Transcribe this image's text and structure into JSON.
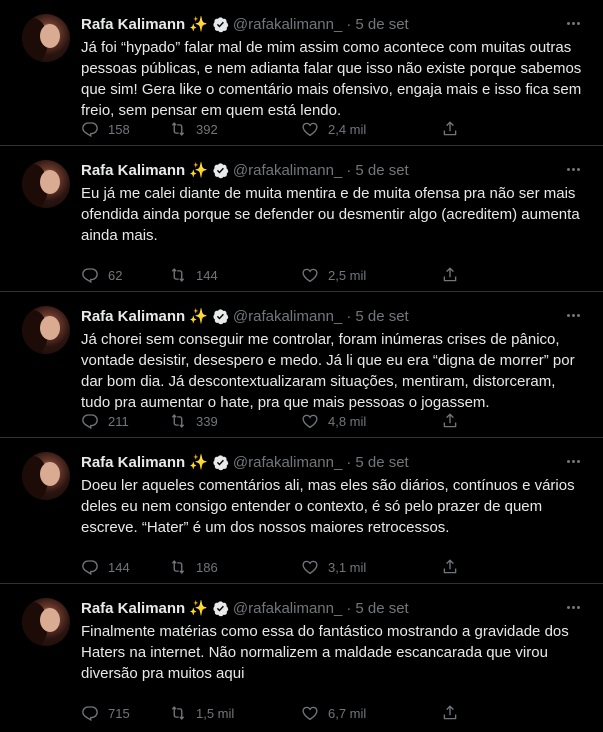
{
  "author": {
    "name": "Rafa Kalimann",
    "emoji": "✨",
    "handle": "@rafakalimann_",
    "separator": "·"
  },
  "icons": {
    "verified": "verified-badge-icon",
    "more": "more-icon",
    "reply": "reply-icon",
    "retweet": "retweet-icon",
    "like": "heart-icon",
    "share": "share-icon"
  },
  "colors": {
    "background": "#000000",
    "text": "#e7e9ea",
    "muted": "#71767b",
    "divider": "#2f3336"
  },
  "tweets": [
    {
      "time": "5 de set",
      "text": "Já foi “hypado” falar mal de mim assim como acontece com muitas outras\npessoas públicas, e nem adianta falar que isso não existe porque sabemos\nque sim! Gera like o comentário mais ofensivo, engaja mais e isso fica sem\nfreio, sem pensar em quem está lendo.",
      "replies": "158",
      "retweets": "392",
      "likes": "2,4 mil"
    },
    {
      "time": "5 de set",
      "text": "Eu já me calei diante de muita mentira e de muita ofensa pra não ser mais\nofendida ainda porque se defender ou desmentir algo (acreditem) aumenta\nainda mais.",
      "replies": "62",
      "retweets": "144",
      "likes": "2,5 mil"
    },
    {
      "time": "5 de set",
      "text": "Já chorei sem conseguir me controlar, foram inúmeras crises de pânico,\nvontade desistir, desespero e medo. Já li que eu era “digna de morrer” por\ndar bom dia. Já descontextualizaram situações, mentiram, distorceram,\ntudo pra aumentar o hate, pra que mais pessoas o jogassem.",
      "replies": "211",
      "retweets": "339",
      "likes": "4,8 mil"
    },
    {
      "time": "5 de set",
      "text": "Doeu ler aqueles comentários ali, mas eles são diários, contínuos e vários\ndeles eu nem consigo entender o contexto, é só pelo prazer de quem\nescreve. “Hater” é um dos nossos maiores retrocessos.",
      "replies": "144",
      "retweets": "186",
      "likes": "3,1 mil"
    },
    {
      "time": "5 de set",
      "text": "Finalmente matérias como essa do fantástico mostrando a gravidade dos\nHaters na internet. Não normalizem a maldade escancarada que virou\ndiversão pra muitos aqui",
      "replies": "715",
      "retweets": "1,5 mil",
      "likes": "6,7 mil"
    }
  ]
}
